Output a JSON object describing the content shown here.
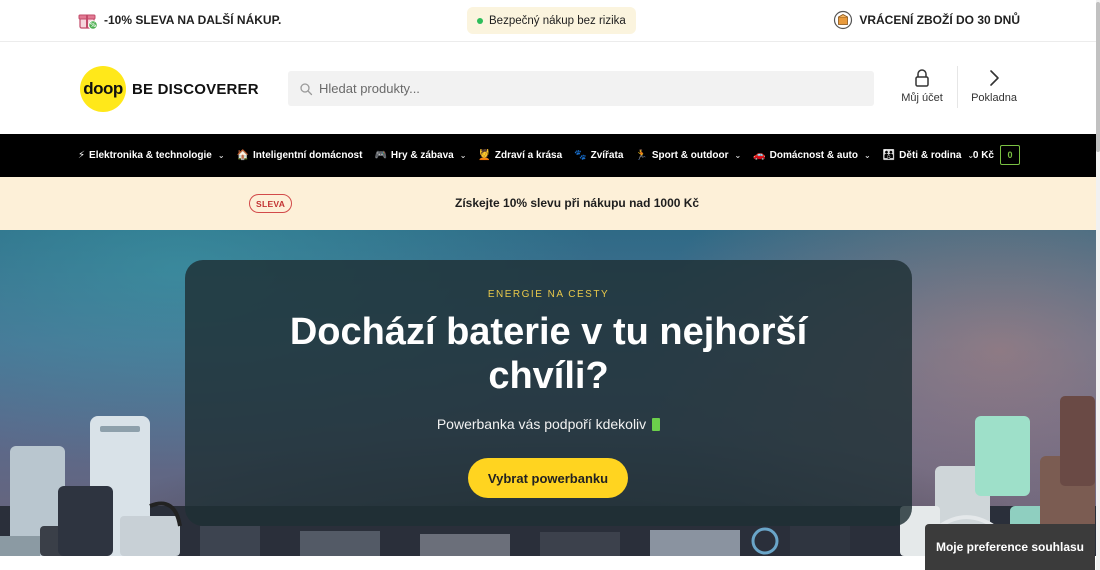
{
  "topbar": {
    "left_text": "-10% SLEVA NA DALŠÍ NÁKUP.",
    "left_icon": "gift-icon",
    "center_text": "Bezpečný nákup bez rizika",
    "center_dot_color": "#2dbd5a",
    "right_text": "VRÁCENÍ ZBOŽÍ DO 30 DNŮ",
    "right_icon": "return-box-icon"
  },
  "header": {
    "logo_mark": "doop",
    "logo_name": "BE DISCOVERER",
    "search_placeholder": "Hledat produkty...",
    "account_label": "Můj účet",
    "checkout_label": "Pokladna",
    "brand_color": "#ffe81a"
  },
  "nav": {
    "items": [
      {
        "emoji": "⚡",
        "label": "Elektronika & technologie",
        "dropdown": true
      },
      {
        "emoji": "🏠",
        "label": "Inteligentní domácnost",
        "dropdown": false
      },
      {
        "emoji": "🎮",
        "label": "Hry & zábava",
        "dropdown": true
      },
      {
        "emoji": "💆",
        "label": "Zdraví a krása",
        "dropdown": false
      },
      {
        "emoji": "🐾",
        "label": "Zvířata",
        "dropdown": false
      },
      {
        "emoji": "🏃",
        "label": "Sport & outdoor",
        "dropdown": true
      },
      {
        "emoji": "🚗",
        "label": "Domácnost & auto",
        "dropdown": true
      },
      {
        "emoji": "👪",
        "label": "Děti & rodina",
        "dropdown": true
      }
    ],
    "cart_total": "0 Kč",
    "cart_count": "0"
  },
  "promo": {
    "badge": "SLEVA",
    "text": "Získejte 10% slevu při nákupu nad 1000 Kč"
  },
  "hero": {
    "eyebrow": "ENERGIE NA CESTY",
    "title": "Dochází baterie v tu nejhorší chvíli?",
    "subtitle": "Powerbanka vás podpoří kdekoliv",
    "cta": "Vybrat powerbanku",
    "cta_color": "#ffd420"
  },
  "consent": {
    "label": "Moje preference souhlasu"
  }
}
